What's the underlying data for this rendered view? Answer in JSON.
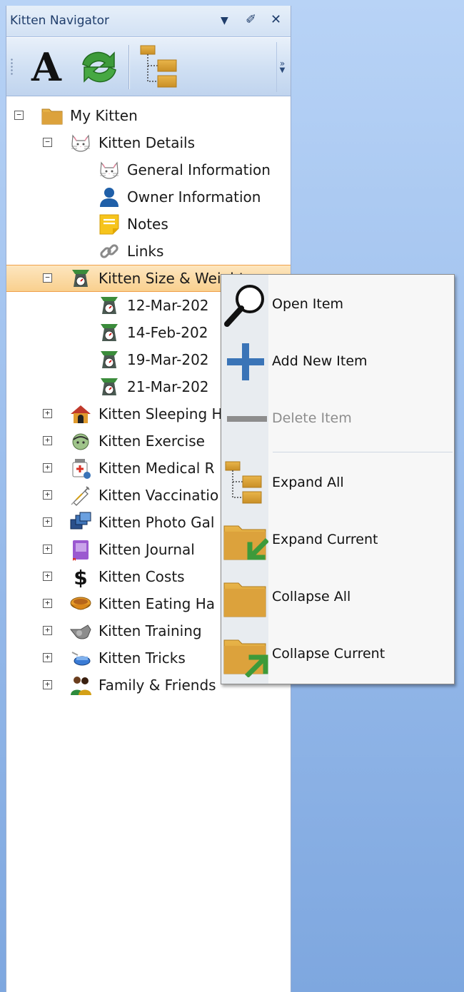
{
  "panel": {
    "title": "Kitten Navigator",
    "dropdown_glyph": "▼",
    "pin_glyph": "✐",
    "close_glyph": "✕"
  },
  "toolbar": {
    "font_letter": "A",
    "overflow_glyph": "»"
  },
  "tree": {
    "root": "My Kitten",
    "kitten_details": "Kitten Details",
    "general_information": "General Information",
    "owner_information": "Owner Information",
    "notes": "Notes",
    "links": "Links",
    "size_weight": "Kitten Size & Weight",
    "sw_entries": [
      "12-Mar-202",
      "14-Feb-202",
      "19-Mar-202",
      "21-Mar-202"
    ],
    "sleeping": "Kitten Sleeping H",
    "exercise": "Kitten Exercise",
    "medical": "Kitten Medical R",
    "vaccinations": "Kitten Vaccinatio",
    "photo": "Kitten Photo Gal",
    "journal": "Kitten Journal",
    "costs": "Kitten Costs",
    "eating": "Kitten Eating Ha",
    "training": "Kitten Training",
    "tricks": "Kitten Tricks",
    "family": "Family & Friends",
    "expanded_glyph": "−",
    "collapsed_glyph": "+"
  },
  "context_menu": {
    "open_item": "Open Item",
    "add_new_item": "Add New Item",
    "delete_item": "Delete Item",
    "expand_all": "Expand All",
    "expand_current": "Expand Current",
    "collapse_all": "Collapse All",
    "collapse_current": "Collapse Current"
  },
  "colors": {
    "folder": "#d9a43a",
    "selection": "#f9d08e",
    "accent_blue": "#3a74b7",
    "accent_green": "#3d9a3a"
  }
}
